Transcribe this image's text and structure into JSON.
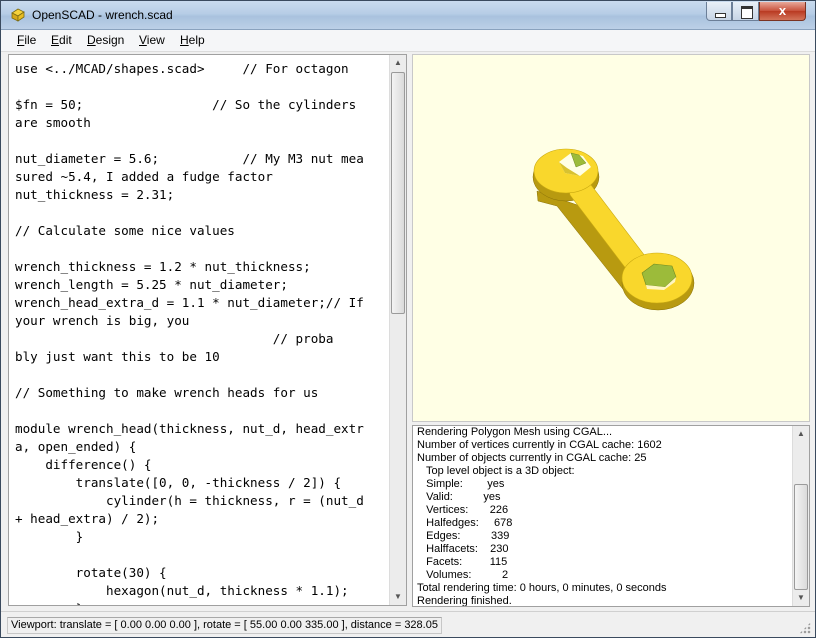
{
  "window": {
    "title": "OpenSCAD - wrench.scad",
    "icon": "openscad-app-icon",
    "close_label": "x"
  },
  "menu": [
    {
      "key": "F",
      "rest": "ile"
    },
    {
      "key": "E",
      "rest": "dit"
    },
    {
      "key": "D",
      "rest": "esign"
    },
    {
      "key": "V",
      "rest": "iew"
    },
    {
      "key": "H",
      "rest": "elp"
    }
  ],
  "editor": {
    "lines": [
      "use <../MCAD/shapes.scad>     // For octagon",
      "",
      "$fn = 50;                 // So the cylinders",
      "are smooth",
      "",
      "nut_diameter = 5.6;           // My M3 nut mea",
      "sured ~5.4, I added a fudge factor",
      "nut_thickness = 2.31;",
      "",
      "// Calculate some nice values",
      "",
      "wrench_thickness = 1.2 * nut_thickness;",
      "wrench_length = 5.25 * nut_diameter;",
      "wrench_head_extra_d = 1.1 * nut_diameter;// If",
      "your wrench is big, you",
      "                                  // proba",
      "bly just want this to be 10",
      "",
      "// Something to make wrench heads for us",
      "",
      "module wrench_head(thickness, nut_d, head_extr",
      "a, open_ended) {",
      "    difference() {",
      "        translate([0, 0, -thickness / 2]) {",
      "            cylinder(h = thickness, r = (nut_d",
      "+ head_extra) / 2);",
      "        }",
      "",
      "        rotate(30) {",
      "            hexagon(nut_d, thickness * 1.1);",
      "        }"
    ]
  },
  "console": {
    "lines": [
      "Rendering Polygon Mesh using CGAL...",
      "Number of vertices currently in CGAL cache: 1602",
      "Number of objects currently in CGAL cache: 25",
      "   Top level object is a 3D object:",
      "   Simple:        yes",
      "   Valid:          yes",
      "   Vertices:       226",
      "   Halfedges:     678",
      "   Edges:          339",
      "   Halffacets:    230",
      "   Facets:         115",
      "   Volumes:          2",
      "Total rendering time: 0 hours, 0 minutes, 0 seconds",
      "Rendering finished."
    ]
  },
  "statusbar": {
    "text": "Viewport: translate = [ 0.00 0.00 0.00 ], rotate = [ 55.00 0.00 335.00 ], distance = 328.05"
  },
  "colors": {
    "viewport_bg": "#ffffe5",
    "model_yellow": "#f9d72c",
    "model_green": "#9cbb3a"
  }
}
